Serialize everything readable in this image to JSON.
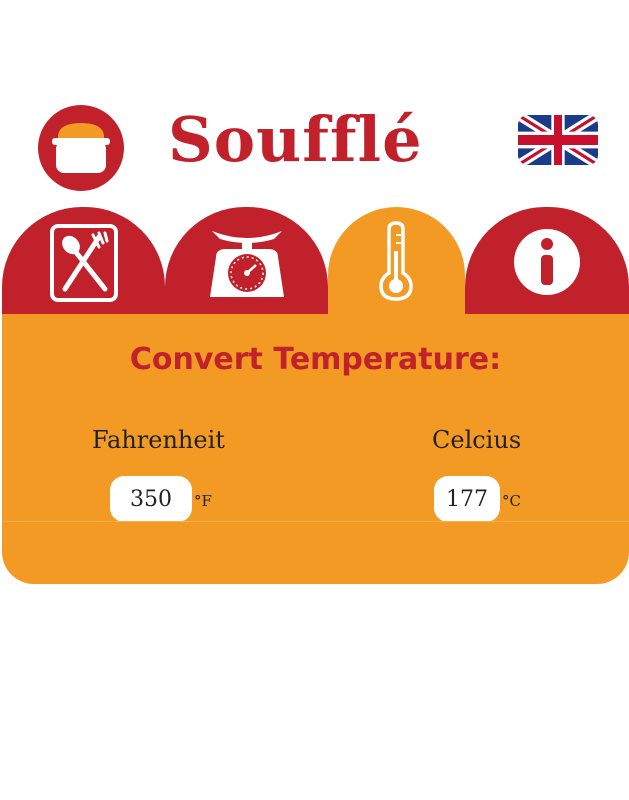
{
  "header": {
    "title": "Soufflé"
  },
  "tabs": [
    {
      "name": "recipes",
      "icon": "spoon-fork-icon"
    },
    {
      "name": "weights",
      "icon": "kitchen-scale-icon"
    },
    {
      "name": "temperature",
      "icon": "thermometer-icon",
      "active": true
    },
    {
      "name": "info",
      "icon": "info-icon"
    }
  ],
  "panel": {
    "title": "Convert Temperature:",
    "fahrenheit": {
      "label": "Fahrenheit",
      "value": "350",
      "unit": "°F"
    },
    "celsius": {
      "label": "Celcius",
      "value": "177",
      "unit": "°C"
    }
  },
  "colors": {
    "primary_red": "#c0212b",
    "accent_orange": "#f39a24"
  }
}
